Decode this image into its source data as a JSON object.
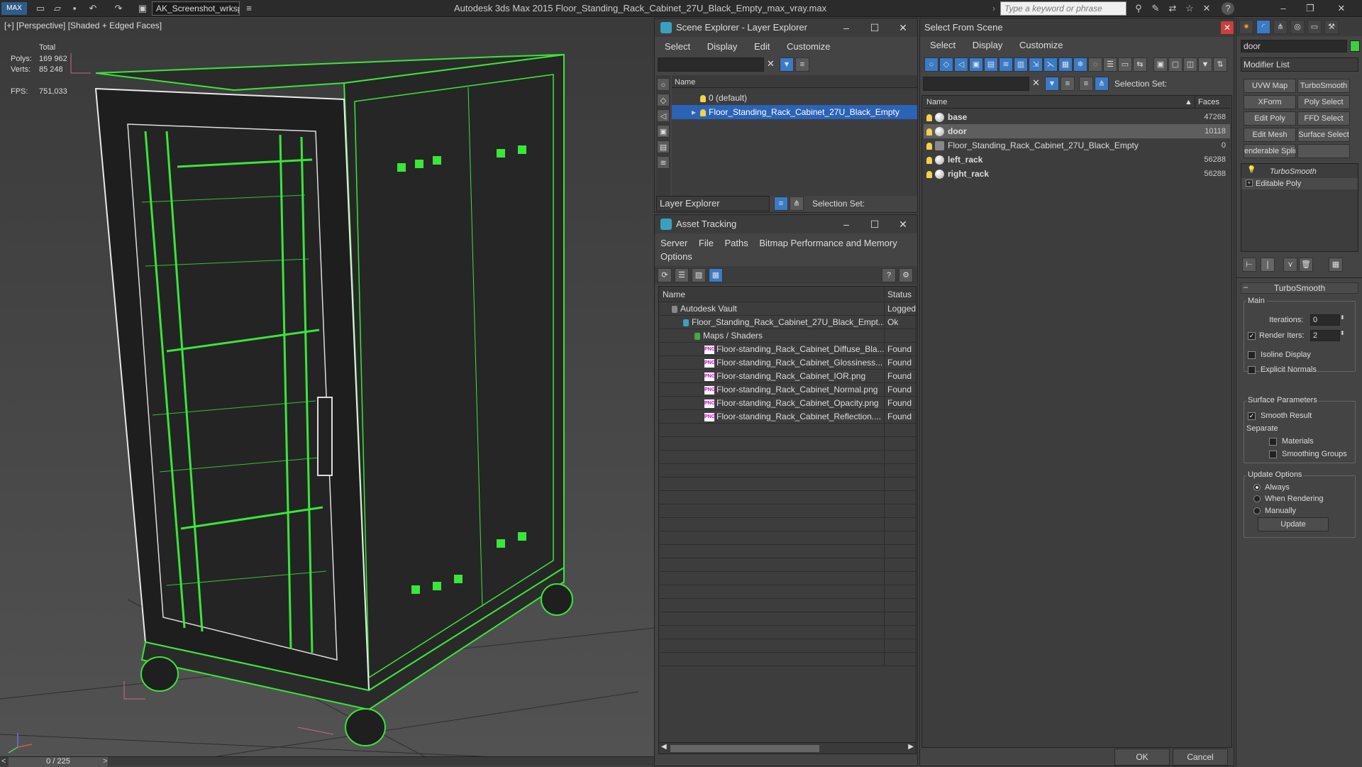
{
  "titlebar": {
    "workspace": "AK_Screenshot_wrksp",
    "title": "Autodesk 3ds Max  2015     Floor_Standing_Rack_Cabinet_27U_Black_Empty_max_vray.max",
    "search_placeholder": "Type a keyword or phrase"
  },
  "viewport": {
    "label": "[+] [Perspective] [Shaded + Edged Faces]",
    "stats": {
      "total_label": "Total",
      "polys_label": "Polys:",
      "polys": "169 962",
      "verts_label": "Verts:",
      "verts": "85 248",
      "fps_label": "FPS:",
      "fps": "751,033"
    },
    "timeslider": "0 / 225"
  },
  "scene_explorer": {
    "title": "Scene Explorer - Layer Explorer",
    "menu": [
      "Select",
      "Display",
      "Edit",
      "Customize"
    ],
    "column": "Name",
    "rows": [
      "0 (default)",
      "Floor_Standing_Rack_Cabinet_27U_Black_Empty"
    ],
    "footer_dropdown": "Layer Explorer",
    "selection_set": "Selection Set:"
  },
  "asset_tracking": {
    "title": "Asset Tracking",
    "menu": [
      "Server",
      "File",
      "Paths",
      "Bitmap Performance and Memory"
    ],
    "menu2": "Options",
    "col_name": "Name",
    "col_status": "Status",
    "rows": [
      {
        "name": "Autodesk Vault",
        "status": "Logged"
      },
      {
        "name": "Floor_Standing_Rack_Cabinet_27U_Black_Empt...",
        "status": "Ok"
      },
      {
        "name": "Maps / Shaders",
        "status": ""
      },
      {
        "name": "Floor-standing_Rack_Cabinet_Diffuse_Bla...",
        "status": "Found"
      },
      {
        "name": "Floor-standing_Rack_Cabinet_Glossiness...",
        "status": "Found"
      },
      {
        "name": "Floor-standing_Rack_Cabinet_IOR.png",
        "status": "Found"
      },
      {
        "name": "Floor-standing_Rack_Cabinet_Normal.png",
        "status": "Found"
      },
      {
        "name": "Floor-standing_Rack_Cabinet_Opacity.png",
        "status": "Found"
      },
      {
        "name": "Floor-standing_Rack_Cabinet_Reflection....",
        "status": "Found"
      }
    ]
  },
  "select_from_scene": {
    "title": "Select From Scene",
    "menu": [
      "Select",
      "Display",
      "Customize"
    ],
    "selection_set": "Selection Set:",
    "col_name": "Name",
    "col_faces": "Faces",
    "rows": [
      {
        "name": "base",
        "faces": "47268"
      },
      {
        "name": "door",
        "faces": "10118"
      },
      {
        "name": "Floor_Standing_Rack_Cabinet_27U_Black_Empty",
        "faces": "0"
      },
      {
        "name": "left_rack",
        "faces": "56288"
      },
      {
        "name": "right_rack",
        "faces": "56288"
      }
    ],
    "ok": "OK",
    "cancel": "Cancel"
  },
  "command_panel": {
    "object_name": "door",
    "modifier_list": "Modifier List",
    "buttons": [
      "UVW Map",
      "TurboSmooth",
      "XForm",
      "Poly Select",
      "Edit Poly",
      "FFD Select",
      "Edit Mesh",
      "Surface Select",
      "enderable Splir",
      ""
    ],
    "stack": [
      "TurboSmooth",
      "Editable Poly"
    ],
    "rollout": "TurboSmooth",
    "main": "Main",
    "iterations_label": "Iterations:",
    "iterations": "0",
    "render_iters_label": "Render Iters:",
    "render_iters": "2",
    "isoline": "Isoline Display",
    "explicit": "Explicit Normals",
    "surface_params": "Surface Parameters",
    "smooth_result": "Smooth Result",
    "separate": "Separate",
    "materials": "Materials",
    "smoothing_groups": "Smoothing Groups",
    "update_options": "Update Options",
    "always": "Always",
    "when_rendering": "When Rendering",
    "manually": "Manually",
    "update": "Update"
  }
}
